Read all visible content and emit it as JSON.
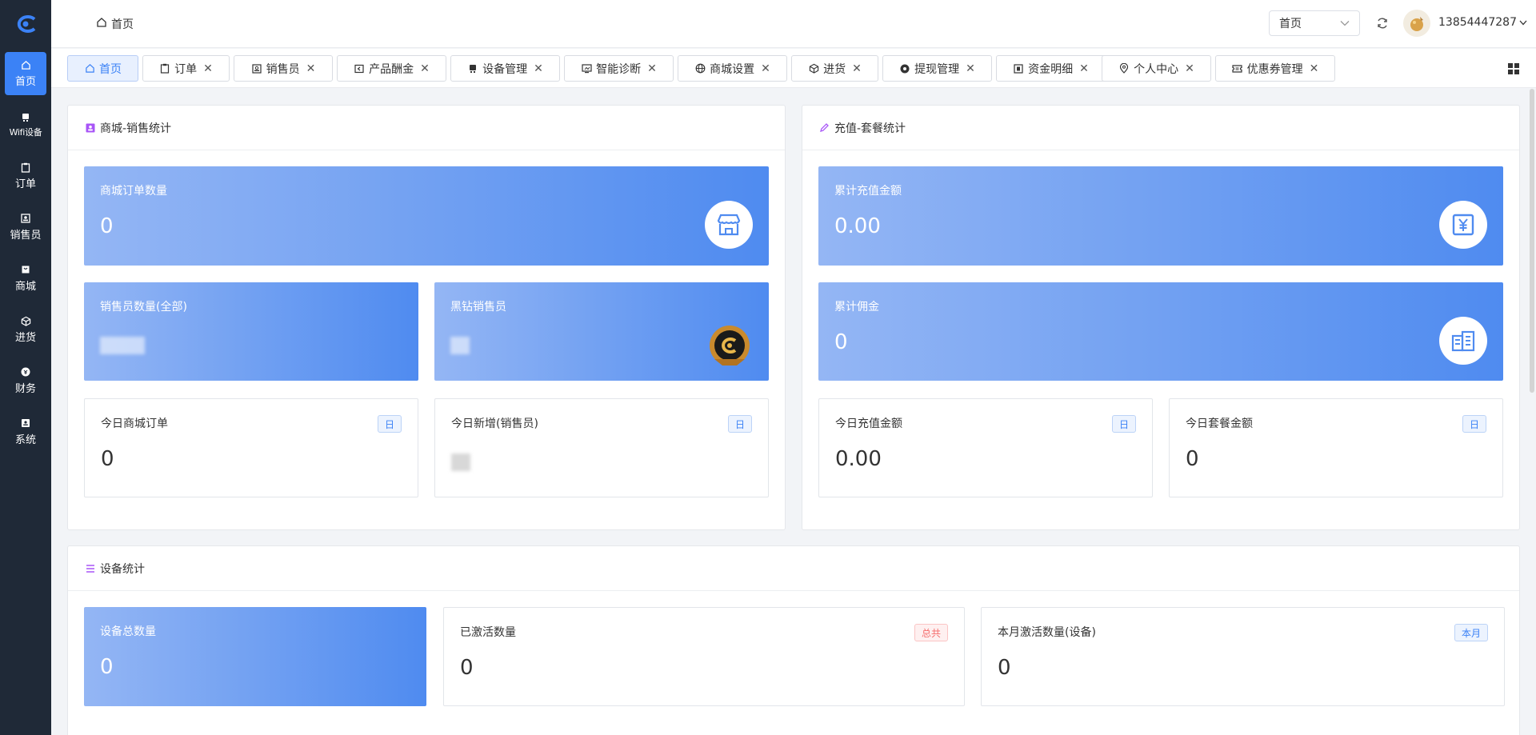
{
  "sidebar": {
    "items": [
      {
        "label": "首页",
        "icon": "home-icon"
      },
      {
        "label": "Wifi设备",
        "icon": "device-icon"
      },
      {
        "label": "订单",
        "icon": "clipboard-icon"
      },
      {
        "label": "销售员",
        "icon": "person-card-icon"
      },
      {
        "label": "商城",
        "icon": "shopping-bag-icon"
      },
      {
        "label": "进货",
        "icon": "box-icon"
      },
      {
        "label": "财务",
        "icon": "coin-icon"
      },
      {
        "label": "系统",
        "icon": "system-icon"
      }
    ]
  },
  "header": {
    "breadcrumb": "首页",
    "select_value": "首页",
    "username": "13854447287"
  },
  "tabs": [
    {
      "label": "首页",
      "icon": "home-icon",
      "closable": false
    },
    {
      "label": "订单",
      "icon": "clipboard-icon"
    },
    {
      "label": "销售员",
      "icon": "person-card-icon"
    },
    {
      "label": "产品酬金",
      "icon": "wallet-icon"
    },
    {
      "label": "设备管理",
      "icon": "device-icon"
    },
    {
      "label": "智能诊断",
      "icon": "monitor-icon"
    },
    {
      "label": "商城设置",
      "icon": "globe-icon"
    },
    {
      "label": "进货",
      "icon": "box-icon"
    },
    {
      "label": "提现管理",
      "icon": "coin-icon"
    },
    {
      "label": "资金明细",
      "icon": "money-icon"
    },
    {
      "label": "个人中心",
      "icon": "location-icon"
    },
    {
      "label": "优惠券管理",
      "icon": "ticket-icon"
    }
  ],
  "sales_panel": {
    "title": "商城-销售统计",
    "order_count": {
      "title": "商城订单数量",
      "value": "0"
    },
    "sales_count": {
      "title": "销售员数量(全部)"
    },
    "black_diamond": {
      "title": "黑钻销售员"
    },
    "today_orders": {
      "title": "今日商城订单",
      "badge": "日",
      "value": "0"
    },
    "today_new_sales": {
      "title": "今日新增(销售员)",
      "badge": "日"
    }
  },
  "recharge_panel": {
    "title": "充值-套餐统计",
    "total_recharge": {
      "title": "累计充值金额",
      "value": "0.00"
    },
    "total_commission": {
      "title": "累计佣金",
      "value": "0"
    },
    "today_recharge": {
      "title": "今日充值金额",
      "badge": "日",
      "value": "0.00"
    },
    "today_package": {
      "title": "今日套餐金额",
      "badge": "日",
      "value": "0"
    }
  },
  "device_panel": {
    "title": "设备统计",
    "total": {
      "title": "设备总数量",
      "value": "0"
    },
    "activated": {
      "title": "已激活数量",
      "badge": "总共",
      "value": "0"
    },
    "month_activated": {
      "title": "本月激活数量(设备)",
      "badge": "本月",
      "value": "0"
    }
  }
}
